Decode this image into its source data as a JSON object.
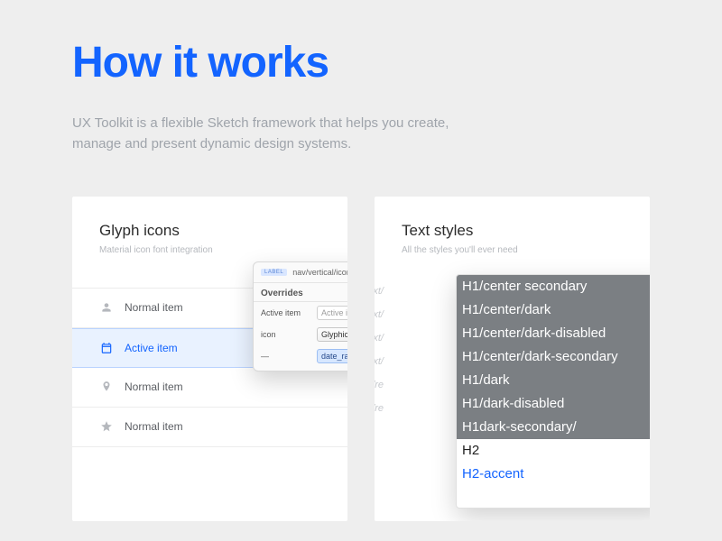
{
  "header": {
    "title": "How it works",
    "subtitle": "UX Toolkit is a flexible Sketch framework that helps you create, manage and present dynamic design systems."
  },
  "glyph_card": {
    "title": "Glyph icons",
    "subtitle": "Material icon font integration",
    "items": [
      {
        "label": "Normal item",
        "icon": "person",
        "active": false
      },
      {
        "label": "Active item",
        "icon": "calendar",
        "active": true
      },
      {
        "label": "Normal item",
        "icon": "pin",
        "active": false
      },
      {
        "label": "Normal item",
        "icon": "star",
        "active": false
      }
    ],
    "overrides": {
      "tag": "LABEL",
      "breadcrumb": "nav/vertical/icon label/active",
      "section": "Overrides",
      "rows": [
        {
          "label": "Active item",
          "type": "input",
          "value": "Active item"
        },
        {
          "label": "icon",
          "type": "select",
          "value": "Glyphicon/primary M"
        },
        {
          "label": "—",
          "type": "hl",
          "value": "date_range"
        }
      ]
    }
  },
  "text_card": {
    "title": "Text styles",
    "subtitle": "All the styles you'll ever need",
    "ghost_labels": [
      "text/",
      "text/",
      "text/",
      "text/",
      "text/re",
      "text/re"
    ],
    "styles": [
      {
        "text": "H1/center secondary",
        "variant": "dark"
      },
      {
        "text": "H1/center/dark",
        "variant": "dark"
      },
      {
        "text": "H1/center/dark-disabled",
        "variant": "dark"
      },
      {
        "text": "H1/center/dark-secondary",
        "variant": "dark"
      },
      {
        "text": "H1/dark",
        "variant": "dark"
      },
      {
        "text": "H1/dark-disabled",
        "variant": "dark"
      },
      {
        "text": "H1dark-secondary/",
        "variant": "dark"
      },
      {
        "text": "H2",
        "variant": "plain"
      },
      {
        "text": "H2-accent",
        "variant": "accent"
      }
    ]
  }
}
